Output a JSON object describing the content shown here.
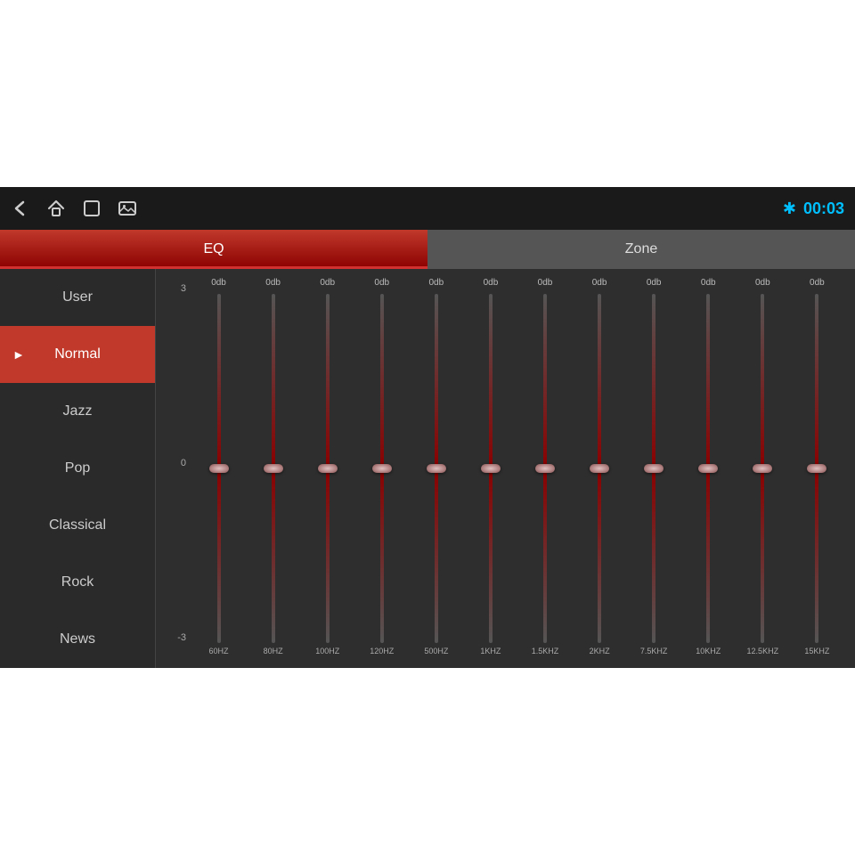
{
  "topBar": {
    "icons": [
      "back-icon",
      "home-icon",
      "window-icon",
      "image-icon"
    ],
    "bluetooth": "✱",
    "time": "00:03"
  },
  "tabs": [
    {
      "id": "eq",
      "label": "EQ",
      "active": true
    },
    {
      "id": "zone",
      "label": "Zone",
      "active": false
    }
  ],
  "sidebar": {
    "items": [
      {
        "id": "user",
        "label": "User",
        "active": false
      },
      {
        "id": "normal",
        "label": "Normal",
        "active": true
      },
      {
        "id": "jazz",
        "label": "Jazz",
        "active": false
      },
      {
        "id": "pop",
        "label": "Pop",
        "active": false
      },
      {
        "id": "classical",
        "label": "Classical",
        "active": false
      },
      {
        "id": "rock",
        "label": "Rock",
        "active": false
      },
      {
        "id": "news",
        "label": "News",
        "active": false
      }
    ]
  },
  "eq": {
    "scaleLabels": [
      "3",
      "0",
      "-3"
    ],
    "bands": [
      {
        "freq": "60HZ",
        "db": "0db",
        "value": 0
      },
      {
        "freq": "80HZ",
        "db": "0db",
        "value": 0
      },
      {
        "freq": "100HZ",
        "db": "0db",
        "value": 0
      },
      {
        "freq": "120HZ",
        "db": "0db",
        "value": 0
      },
      {
        "freq": "500HZ",
        "db": "0db",
        "value": 0
      },
      {
        "freq": "1KHZ",
        "db": "0db",
        "value": 0
      },
      {
        "freq": "1.5KHZ",
        "db": "0db",
        "value": 0
      },
      {
        "freq": "2KHZ",
        "db": "0db",
        "value": 0
      },
      {
        "freq": "7.5KHZ",
        "db": "0db",
        "value": 0
      },
      {
        "freq": "10KHZ",
        "db": "0db",
        "value": 0
      },
      {
        "freq": "12.5KHZ",
        "db": "0db",
        "value": 0
      },
      {
        "freq": "15KHZ",
        "db": "0db",
        "value": 0
      }
    ]
  }
}
